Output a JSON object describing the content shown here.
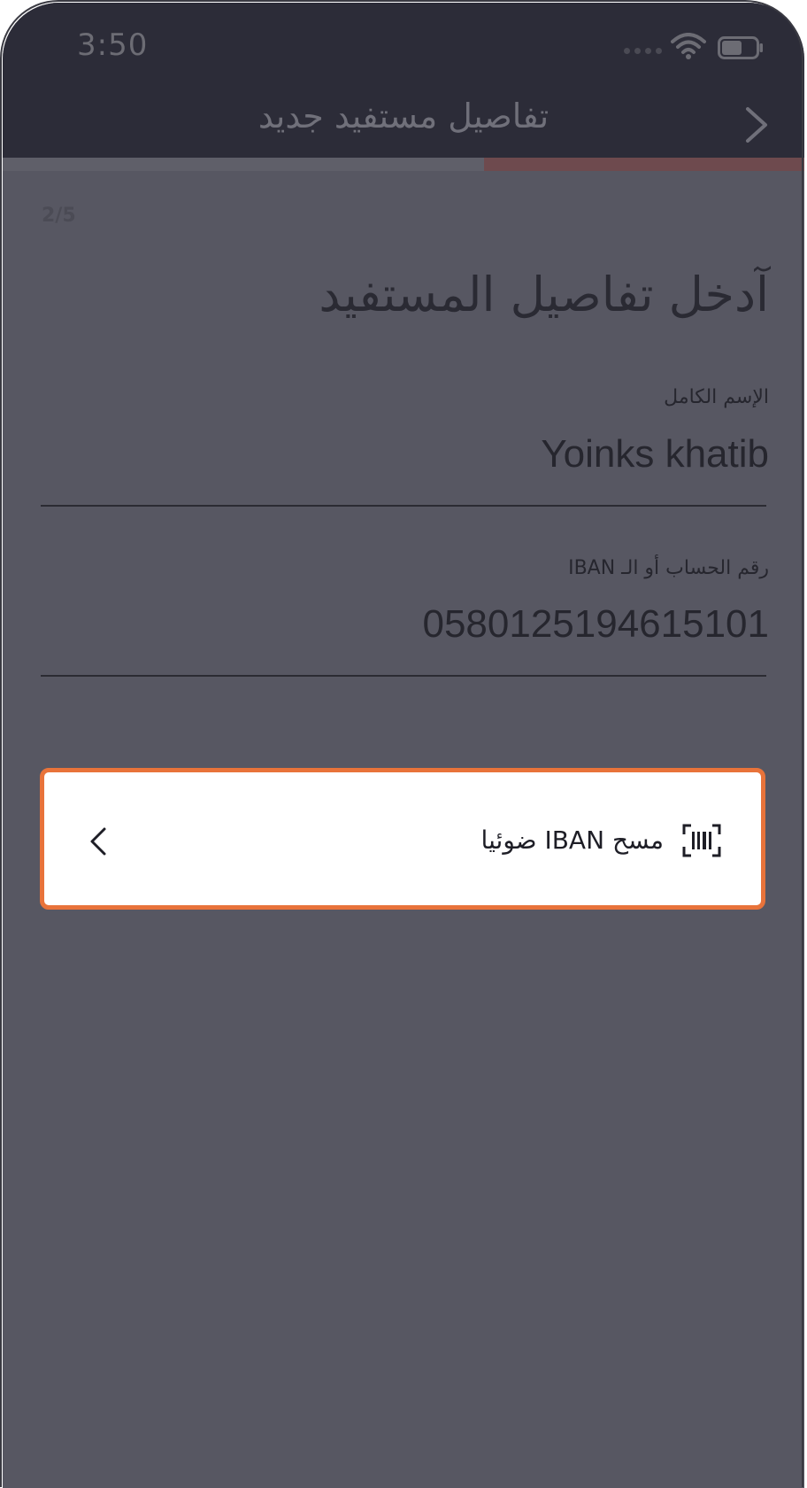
{
  "status_bar": {
    "time": "3:50"
  },
  "nav": {
    "title": "تفاصيل مستفيد جديد"
  },
  "progress": {
    "fraction": 0.4,
    "step_label": "2/5"
  },
  "form": {
    "heading": "آدخل تفاصيل المستفيد",
    "full_name": {
      "label": "الإسم الكامل",
      "value": "Yoinks khatib"
    },
    "account": {
      "label": "رقم الحساب أو الـ IBAN",
      "value": "0580125194615101"
    }
  },
  "scan_card": {
    "label": "مسح IBAN ضوئيا"
  },
  "colors": {
    "overlay": "#575762",
    "nav_background": "#2c2c38",
    "progress_fill": "#6e4a4e",
    "highlight_border": "#e8733a",
    "card_background": "#ffffff"
  },
  "icons": {
    "back": "chevron-right-icon",
    "scan": "barcode-scan-icon",
    "card_action": "chevron-left-icon",
    "wifi": "wifi-icon",
    "battery": "battery-icon"
  }
}
